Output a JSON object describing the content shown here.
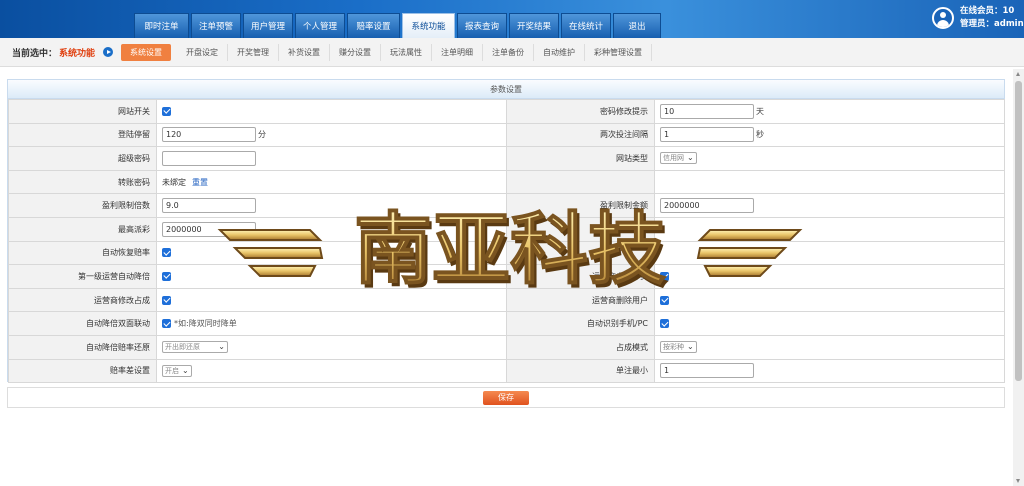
{
  "nav": {
    "items": [
      "即时注单",
      "注单预警",
      "用户管理",
      "个人管理",
      "赔率设置",
      "系统功能",
      "报表查询",
      "开奖结果",
      "在线统计",
      "退出"
    ],
    "active": 5
  },
  "user": {
    "online": "在线会员：10",
    "admin": "管理员：admin"
  },
  "subbar": {
    "label": "当前选中：",
    "current": "系统功能",
    "tabs": [
      "系统设置",
      "开盘设定",
      "开奖管理",
      "补货设置",
      "赚分设置",
      "玩法属性",
      "注单明细",
      "注单备份",
      "自动维护",
      "彩种管理设置"
    ],
    "active": 0
  },
  "panel": {
    "title": "参数设置"
  },
  "form": {
    "site_switch": "网站开关",
    "pwd_tip": "密码修改提示",
    "pwd_tip_value": "10",
    "pwd_tip_unit": "天",
    "login_stop": "登陆停留",
    "login_stop_value": "120",
    "login_stop_unit": "分",
    "bet_interval": "两次投注间隔",
    "bet_interval_value": "1",
    "bet_interval_unit": "秒",
    "super_pwd": "超级密码",
    "super_pwd_value": "",
    "site_type": "网站类型",
    "site_type_value": "信用网",
    "transfer_pwd": "转账密码",
    "transfer_pwd_status": "未绑定",
    "transfer_pwd_reset": "重置",
    "profit_limit_multiple": "盈利限制倍数",
    "profit_limit_multiple_value": "9.0",
    "profit_limit_amount": "盈利限制金额",
    "profit_limit_amount_value": "2000000",
    "max_rebate": "最高派彩",
    "max_rebate_value": "2000000",
    "credit_clear": "信用额度归零",
    "auto_odds_restore": "自动恢复赔率",
    "level1_auto_drop": "第一级运营自动降倍",
    "operator_auto_fill": "运营商自动补货",
    "operator_modify_share": "运营商修改占成",
    "operator_delete_user": "运营商删除用户",
    "auto_drop_link": "自动降倍双面联动",
    "auto_drop_link_note": "*如:降双同时降单",
    "auto_detect_phone": "自动识别手机/PC",
    "auto_drop_restore": "自动降倍赔率还原",
    "auto_drop_restore_value": "开出即还原",
    "share_mode": "占成模式",
    "share_mode_value": "按彩种",
    "odds_diff": "赔率差设置",
    "odds_diff_value": "开启",
    "min_bet": "单注最小",
    "min_bet_value": "1"
  },
  "save": {
    "label": "保存"
  },
  "watermark": {
    "text": "南亚科技"
  }
}
